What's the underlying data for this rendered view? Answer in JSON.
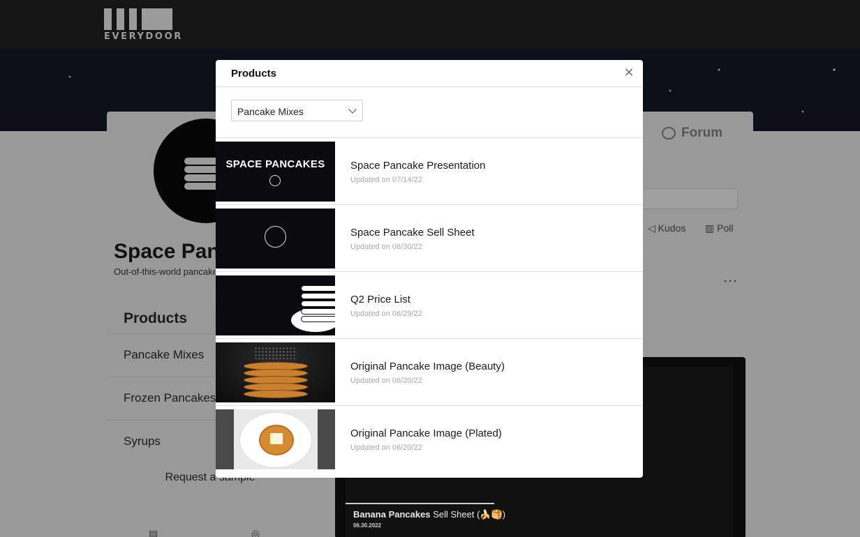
{
  "brand": {
    "name": "EVERYDOOR"
  },
  "profile": {
    "name": "Space Pancakes",
    "tagline": "Out-of-this-world pancakes"
  },
  "sidebar": {
    "title": "Products",
    "items": [
      {
        "label": "Pancake Mixes"
      },
      {
        "label": "Frozen Pancakes"
      },
      {
        "label": "Syrups"
      }
    ],
    "request_label": "Request a sample"
  },
  "tabs": {
    "forum_label": "Forum"
  },
  "composer": {
    "kudos_label": "Kudos",
    "poll_label": "Poll"
  },
  "feed": {
    "more_label": "···",
    "caption_bold": "Banana Pancakes",
    "caption_rest": " Sell Sheet (🍌🥞)",
    "caption_date": "06.30.2022"
  },
  "modal": {
    "title": "Products",
    "close_glyph": "×",
    "filter": {
      "selected": "Pancake Mixes"
    },
    "items": [
      {
        "title": "Space Pancake Presentation",
        "updated": "Updated on 07/14/22",
        "thumb_text": "SPACE PANCAKES"
      },
      {
        "title": "Space Pancake Sell Sheet",
        "updated": "Updated on 06/30/22"
      },
      {
        "title": "Q2 Price List",
        "updated": "Updated on 06/29/22"
      },
      {
        "title": "Original Pancake Image (Beauty)",
        "updated": "Updated on 06/20/22"
      },
      {
        "title": "Original Pancake Image (Plated)",
        "updated": "Updated on 06/20/22"
      }
    ]
  },
  "colors": {
    "overlay": "#9a9a9a",
    "topbar": "#151515",
    "modal_bg": "#ffffff",
    "muted_text": "#a7a7a7"
  }
}
